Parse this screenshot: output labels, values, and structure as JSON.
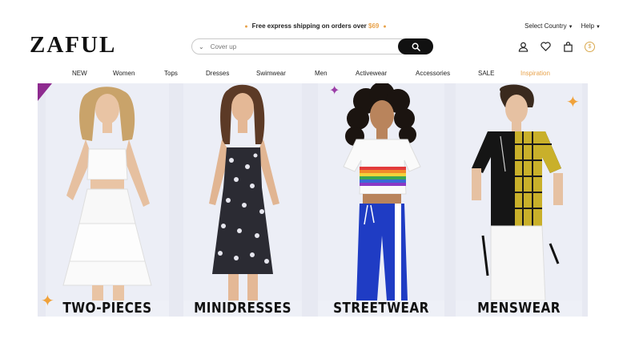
{
  "topbar": {
    "promo_text": "Free express shipping on orders over",
    "promo_amount": "$69",
    "select_country": "Select Country",
    "help": "Help"
  },
  "header": {
    "logo": "ZAFUL",
    "search_placeholder": "Cover up",
    "icons": [
      "user-icon",
      "heart-icon",
      "bag-icon",
      "coin-icon"
    ]
  },
  "nav": {
    "items": [
      "NEW",
      "Women",
      "Tops",
      "Dresses",
      "Swimwear",
      "Men",
      "Activewear",
      "Accessories",
      "SALE",
      "Inspiration"
    ],
    "highlight_color": "#e8a24a"
  },
  "banner": {
    "panels": [
      {
        "label": "TWO-PIECES"
      },
      {
        "label": "MINIDRESSES"
      },
      {
        "label": "STREETWEAR"
      },
      {
        "label": "MENSWEAR"
      }
    ],
    "accent_colors": {
      "star": "#f0a23b",
      "corner": "#8e2b8f"
    }
  }
}
